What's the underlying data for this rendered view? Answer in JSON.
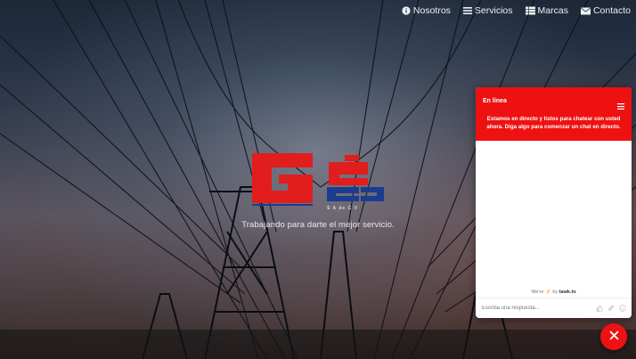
{
  "nav": {
    "items": [
      {
        "label": "Nosotros",
        "icon": "info-icon"
      },
      {
        "label": "Servicios",
        "icon": "list-icon"
      },
      {
        "label": "Marcas",
        "icon": "table-icon"
      },
      {
        "label": "Contacto",
        "icon": "envelope-icon"
      }
    ]
  },
  "hero": {
    "logo_text": "Gea",
    "logo_sub": "S A  de  C V",
    "tagline": "Trabajando para darte el mejor servicio."
  },
  "chat": {
    "status": "En línea",
    "message": "Estamos en directo y listos para chatear con usted ahora. Diga algo para comenzar un chat en directo.",
    "powered_prefix": "We're",
    "powered_by": "by",
    "powered_brand": "tawk.to",
    "input_placeholder": "Escriba una respuesta...",
    "accent": "#ee1111"
  }
}
